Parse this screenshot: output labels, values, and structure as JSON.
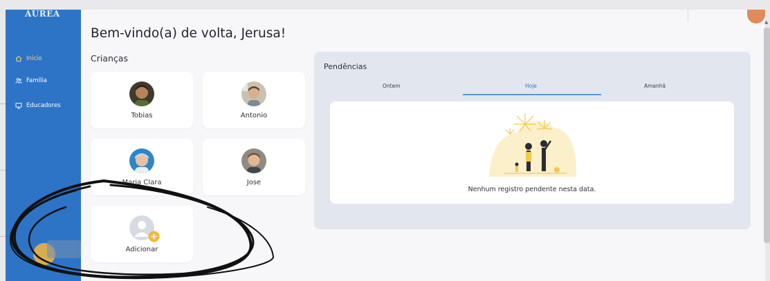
{
  "sidebar": {
    "logo": "ÁUREA",
    "items": [
      {
        "label": "Início",
        "icon": "home-icon",
        "active": true
      },
      {
        "label": "Família",
        "icon": "family-icon",
        "active": false
      },
      {
        "label": "Educadores",
        "icon": "educators-icon",
        "active": false
      }
    ]
  },
  "header": {
    "welcome": "Bem-vindo(a) de volta, Jerusa!"
  },
  "children": {
    "title": "Crianças",
    "cards": [
      {
        "name": "Tobias",
        "avatar": "child-photo"
      },
      {
        "name": "Antonio",
        "avatar": "child-photo"
      },
      {
        "name": "Maria Clara",
        "avatar": "child-photo"
      },
      {
        "name": "Jose",
        "avatar": "child-photo"
      }
    ],
    "add_label": "Adicionar"
  },
  "pending": {
    "title": "Pendências",
    "tabs": [
      {
        "label": "Ontem",
        "active": false
      },
      {
        "label": "Hoje",
        "active": true
      },
      {
        "label": "Amanhã",
        "active": false
      }
    ],
    "empty_message": "Nenhum registro pendente nesta data."
  },
  "colors": {
    "sidebar": "#2e74c6",
    "active_nav": "#ffd766",
    "panel": "#e2e6ee",
    "tab_underline": "#5e94d6",
    "add_badge": "#f4b73b"
  }
}
